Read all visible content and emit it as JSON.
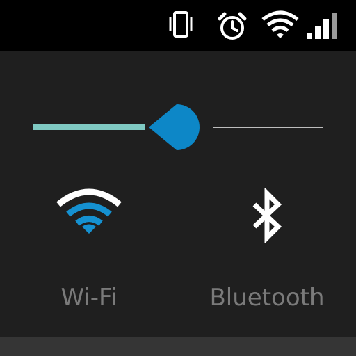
{
  "status_bar": {
    "icons": [
      "vibrate-icon",
      "alarm-icon",
      "wifi-signal-icon",
      "cell-signal-icon"
    ],
    "background": "#000000",
    "icon_color": "#ffffff"
  },
  "brightness_slider": {
    "value_fraction": 0.4,
    "active_color": "#7fc9c2",
    "thumb_color": "#0d87c7",
    "track_color": "#bdbdbd"
  },
  "tiles": [
    {
      "label": "Wi-Fi",
      "icon": "wifi-icon",
      "color": "#1591d1"
    },
    {
      "label": "Bluetooth",
      "icon": "bluetooth-icon",
      "color": "#ffffff"
    }
  ],
  "panel": {
    "background": "#1f1f1f",
    "label_color": "#7a7a7a"
  }
}
